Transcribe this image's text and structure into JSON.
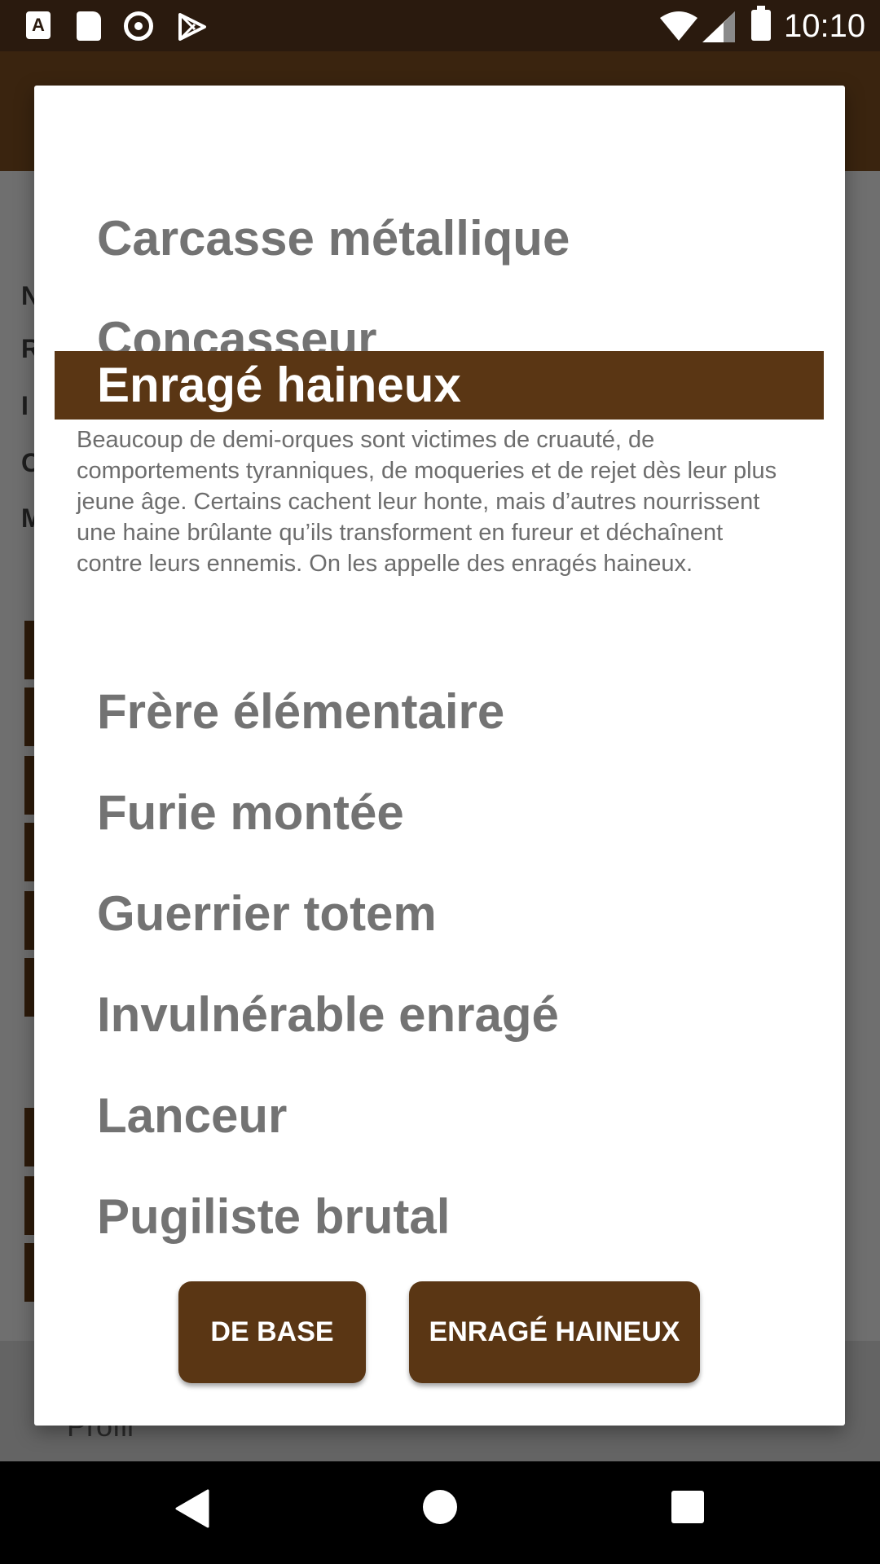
{
  "status_bar": {
    "time": "10:10",
    "left_icons": [
      "a-notification-icon",
      "sd-card-icon",
      "record-icon",
      "play-store-icon"
    ],
    "right_icons": [
      "wifi-icon",
      "signal-icon",
      "battery-icon"
    ],
    "a_glyph": "A"
  },
  "dialog": {
    "options": [
      {
        "label": "Carcasse métallique",
        "selected": false
      },
      {
        "label": "Concasseur",
        "selected": false
      },
      {
        "label": "Enragé haineux",
        "selected": true
      },
      {
        "label": "Frère élémentaire",
        "selected": false
      },
      {
        "label": "Furie montée",
        "selected": false
      },
      {
        "label": "Guerrier totem",
        "selected": false
      },
      {
        "label": "Invulnérable enragé",
        "selected": false
      },
      {
        "label": "Lanceur",
        "selected": false
      },
      {
        "label": "Pugiliste brutal",
        "selected": false
      }
    ],
    "selected_description": "Beaucoup de demi-orques sont victimes de cruauté, de comportements tyranniques, de moqueries et de rejet dès leur plus jeune âge. Certains cachent leur honte, mais d’autres nourrissent une haine brûlante qu’ils transforment en fureur et déchaînent contre leurs ennemis. On les appelle des enragés haineux.",
    "buttons": {
      "base_label": "DE BASE",
      "confirm_label": "ENRAGÉ HAINEUX"
    }
  },
  "background": {
    "profile_label": "Profil",
    "row_initials": [
      "N",
      "R",
      "I",
      "C",
      "M"
    ]
  },
  "colors": {
    "accent": "#5a3614",
    "status_bar": "#2a1a0e",
    "toolbar_dimmed": "#3a240f",
    "option_text": "#737373",
    "scrim": "#6f6f6f"
  }
}
